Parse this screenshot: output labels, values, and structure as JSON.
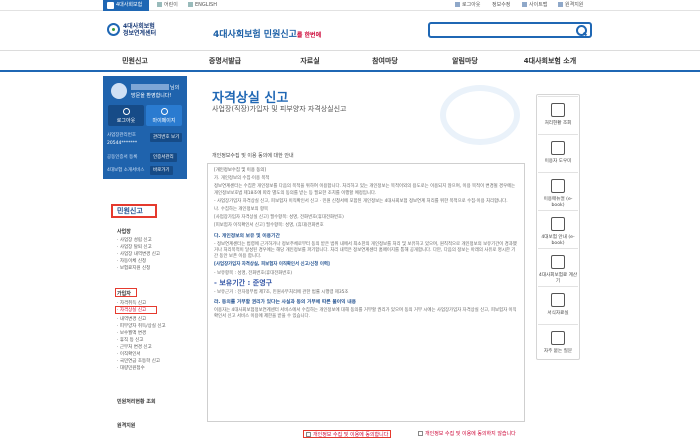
{
  "topbar": {
    "home": "4대사회보험",
    "lang1": "어린이",
    "lang2": "ENGLISH",
    "util": [
      "로그아웃",
      "정보수정",
      "사이트맵",
      "원격지원"
    ]
  },
  "header": {
    "logo_line1": "4대사회보험",
    "logo_line2": "정보연계센터",
    "slogan_main": "4대사회보험 민원신고",
    "slogan_sub": "를 한번에"
  },
  "gnb": [
    "민원신고",
    "증명서발급",
    "자료실",
    "참여마당",
    "알림마당",
    "4대사회보험 소개"
  ],
  "sidebar": {
    "nim": "님의",
    "welcome": "방문을 환영합니다!",
    "logout": "로그아웃",
    "mypage": "마이페이지",
    "row1_label": "사업장관리번호",
    "row1_val": "20544*******",
    "row1_tag": "관리번호 보기",
    "row2_label": "공동인증서 등록",
    "row2_tag": "인증서관리",
    "row3_label": "4대보험 소개서비스",
    "row3_tag": "바로가기",
    "section": "민원신고",
    "group1": "사업장",
    "group1_items": [
      "사업장 성립 신고",
      "사업장 탈퇴 신고",
      "사업장 내역변경 신고",
      "자동이체 신청",
      "보험료지원 신청"
    ],
    "group2": "가입자",
    "group2_items": [
      "자격취득 신고",
      "자격상실 신고",
      "내역변경 신고",
      "피부양자 취득/상실 신고",
      "보수월액 변경",
      "휴직 등 신고",
      "근무처 변경 신고",
      "이직확인서",
      "국민연금 초등학 신고",
      "대량민원접수"
    ],
    "group3": "민원처리현황 조회",
    "group4": "원격지원"
  },
  "content": {
    "title": "자격상실 신고",
    "subtitle": "사업장(직장)가입자 및 피부양자 자격상실신고",
    "intro": "개인정보수집 및 이용 동의에 대한 안내",
    "terms": [
      {
        "cls": "q",
        "text": "[개인정보수집 및 이용 동의]"
      },
      {
        "cls": "",
        "text": "가. 개인정보의 수집·이용 목적"
      },
      {
        "cls": "",
        "text": "정보연계센터는 수집한 개인정보를 다음의 목적을 위하여 이용합니다. 처리하고 있는 개인정보는 목적이외의 용도로는 이용되지 않으며, 이용 목적이 변경될 경우에는 개인정보보호법 제18조에 따라 별도의 동의를 받는 등 필요한 조치를 이행할 예정입니다."
      },
      {
        "cls": "",
        "text": "- 사업장가입자 자격상실 신고, 피보험자 이직확인서 신고 · 민원 신청서에 포함된 개인정보는 4대사회보험 정보연계 처리를 위한 목적으로 수집·이용 처리합니다."
      },
      {
        "cls": "",
        "text": "나. 수집하는 개인정보의 항목"
      },
      {
        "cls": "",
        "text": "[사업장가입자 자격상실 신고] 필수항목: 성명, 전화번호(휴대전화번호)"
      },
      {
        "cls": "",
        "text": "[피보험자 이직확인서 신고] 필수항목: 성명, (휴대)전화번호"
      },
      {
        "cls": "h",
        "text": "다. 개인정보의 보유 및 이용기간"
      },
      {
        "cls": "",
        "text": "- 정보연계센터는 법령에 근거하거나 정보주체로부터 동의 받은 범위 내에서 최소한의 개인정보를 처리 및 보유하고 있으며, 원칙적으로 개인정보의 보유기간이 경과했거나 처리목적이 달성된 경우에는 해당 개인정보를 파기합니다. 처리 내역은 정보연계센터 홈페이지를 통해 공개합니다. 다만, 다음의 정보는 아래의 사유로 명시한 기간 동안 보존 이용 합니다."
      },
      {
        "cls": "blue",
        "text": "[사업장가입자 자격상실, 피보험자 이직확인서 신고/신청 이력]"
      },
      {
        "cls": "",
        "text": "- 보유항목 : 성명, 전화번호(휴대전화번호)"
      },
      {
        "cls": "big",
        "text": "- 보유기간 : 준영구"
      },
      {
        "cls": "",
        "text": "- 보유근거 : 전자정부법 제7조, 민원사무처리에 관한 법률 시행령 제35조"
      },
      {
        "cls": "h",
        "text": "라. 동의를 거부할 권리가 있다는 사실과 동의 거부에 따른 불이익 내용"
      },
      {
        "cls": "",
        "text": "이용자는 4대사회보험정보연계센터 서비스에서 수집하는 개인정보에 대해 동의를 거부할 권리가 있으며 동의 거부 시에는 사업장가입자 자격상실 신고, 피보험자 이직확인서 신고 서비스 이용에 제한을 받을 수 있습니다."
      }
    ],
    "agree": "개인정보 수집 및 이용에 동의합니다",
    "disagree": "개인정보 수집 및 이용에 동의하지 않습니다"
  },
  "quick": [
    "처리현황 조회",
    "이용자 도우미",
    "이용매뉴얼 (e-book)",
    "4대보험 안내 (e-book)",
    "4대사회보험료 계산기",
    "서식자료실",
    "자주 묻는 질문"
  ],
  "colors": {
    "brand": "#1f67b4",
    "highlight": "#e53a2e"
  }
}
